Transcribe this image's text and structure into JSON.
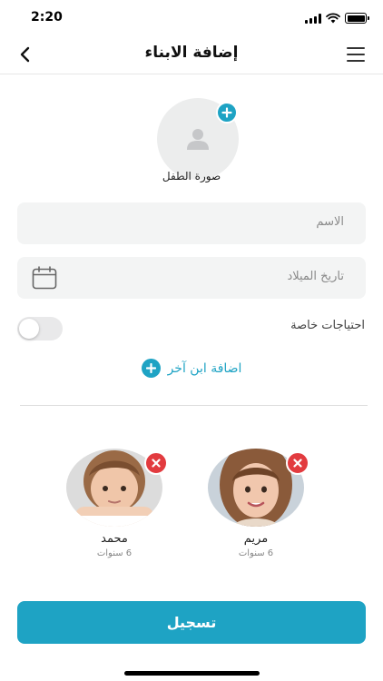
{
  "status_bar": {
    "time": "2:20"
  },
  "nav": {
    "title": "إضافة الابناء"
  },
  "photo": {
    "label": "صورة الطفل"
  },
  "form": {
    "name_placeholder": "الاسم",
    "birthdate_placeholder": "تاريخ الميلاد",
    "special_needs_label": "احتياجات خاصة",
    "special_needs_enabled": false
  },
  "add_another": {
    "label": "اضافة ابن آخر"
  },
  "children": [
    {
      "name": "مريم",
      "age": "6 سنوات"
    },
    {
      "name": "محمد",
      "age": "6 سنوات"
    }
  ],
  "submit": {
    "label": "تسجيل"
  },
  "colors": {
    "accent": "#1ea3c4",
    "remove": "#e23b3f"
  }
}
